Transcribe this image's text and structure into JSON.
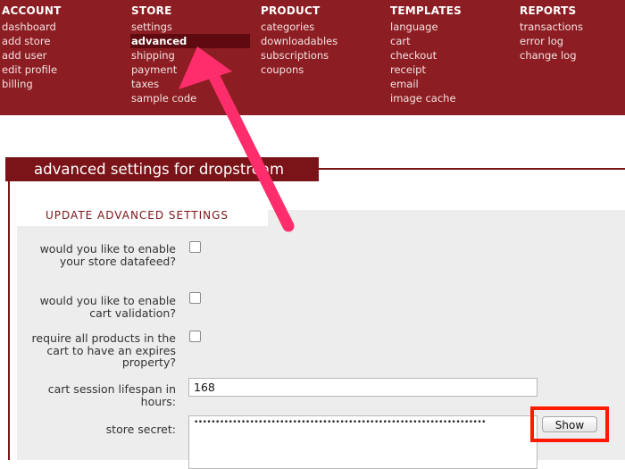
{
  "nav": {
    "account": {
      "heading": "ACCOUNT",
      "items": [
        "dashboard",
        "add store",
        "add user",
        "edit profile",
        "billing"
      ]
    },
    "store": {
      "heading": "STORE",
      "items": [
        "settings",
        "advanced",
        "shipping",
        "payment",
        "taxes",
        "sample code"
      ],
      "active": "advanced"
    },
    "product": {
      "heading": "PRODUCT",
      "items": [
        "categories",
        "downloadables",
        "subscriptions",
        "coupons"
      ]
    },
    "templates": {
      "heading": "TEMPLATES",
      "items": [
        "language",
        "cart",
        "checkout",
        "receipt",
        "email",
        "image cache"
      ]
    },
    "reports": {
      "heading": "REPORTS",
      "items": [
        "transactions",
        "error log",
        "change log"
      ]
    }
  },
  "page": {
    "title": "advanced settings for dropstream",
    "section": "UPDATE ADVANCED SETTINGS"
  },
  "form": {
    "datafeed_label": "would you like to enable your store datafeed?",
    "cart_validation_label": "would you like to enable cart validation?",
    "expires_label": "require all products in the cart to have an expires property?",
    "lifespan_label": "cart session lifespan in hours:",
    "lifespan_value": "168",
    "secret_label": "store secret:",
    "secret_value": "••••••••••••••••••••••••••••••••••••••••••••••••••••••••••••••••••••",
    "show_label": "Show"
  },
  "colors": {
    "nav_bg": "#8c1d22",
    "title_bg": "#7b1418",
    "highlight": "#ff1a00",
    "arrow": "#ff2d6b"
  }
}
